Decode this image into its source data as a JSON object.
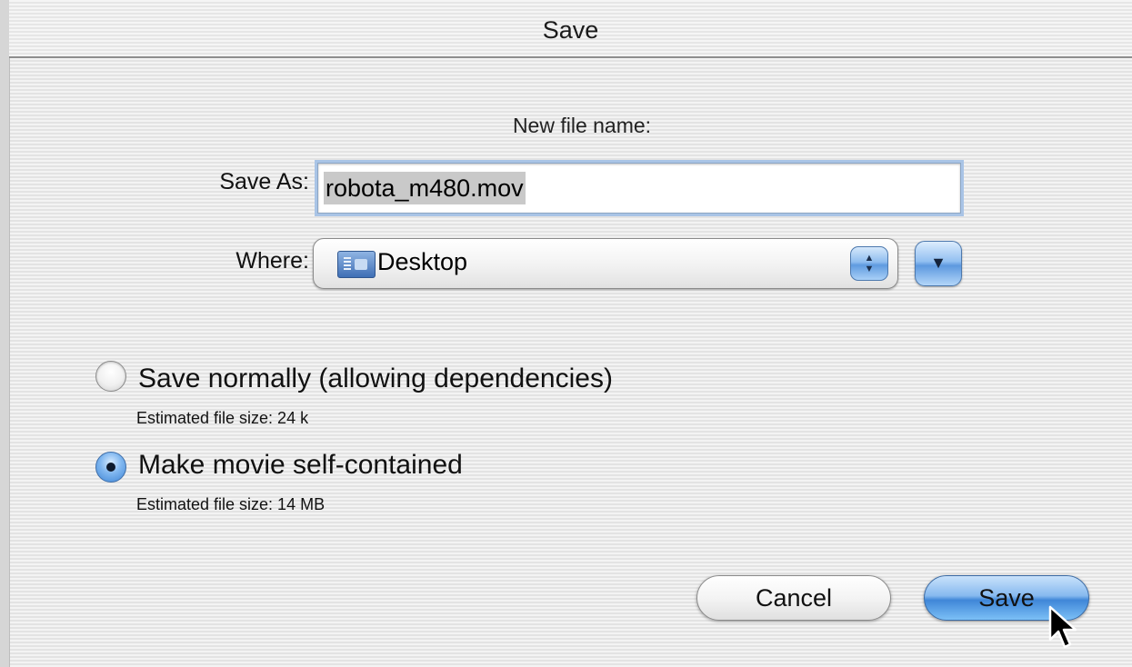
{
  "dialog": {
    "title": "Save"
  },
  "form": {
    "new_file_label": "New file name:",
    "save_as_label": "Save As:",
    "save_as_value": "robota_m480.mov",
    "where_label": "Where:",
    "where_value": "Desktop"
  },
  "options": [
    {
      "label": "Save normally (allowing dependencies)",
      "size_text": "Estimated file size: 24 k",
      "selected": false
    },
    {
      "label": "Make movie self-contained",
      "size_text": "Estimated file size: 14 MB",
      "selected": true
    }
  ],
  "buttons": {
    "cancel": "Cancel",
    "save": "Save"
  },
  "icons": {
    "where_icon": "desktop-folder-icon",
    "stepper": "up-down-stepper-icon",
    "expand": "chevron-down-icon",
    "cursor": "mouse-pointer-icon"
  },
  "colors": {
    "accent": "#3f86d8",
    "background": "#ececec"
  }
}
